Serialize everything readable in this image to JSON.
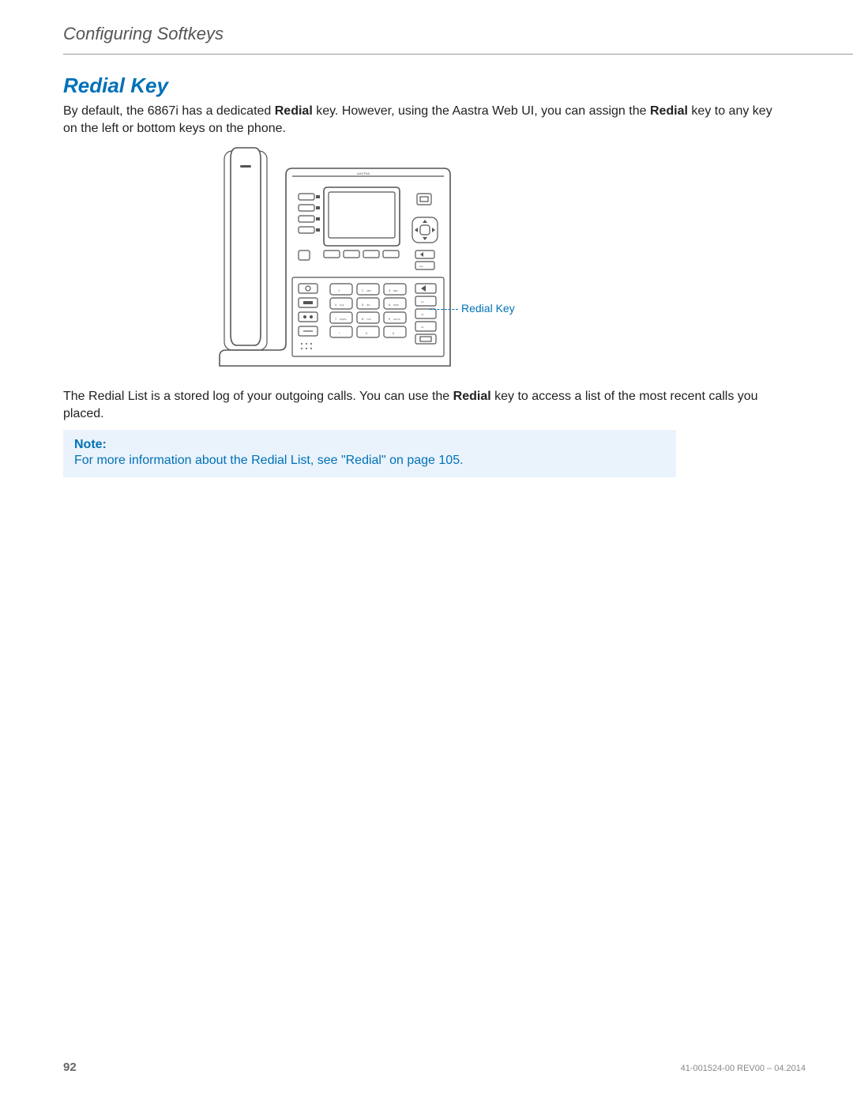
{
  "header": {
    "section": "Configuring Softkeys"
  },
  "section": {
    "title": "Redial Key"
  },
  "paragraphs": {
    "p1_a": "By default, the 6867i has a dedicated ",
    "p1_b": "Redial",
    "p1_c": " key. However, using the Aastra Web UI, you can assign the ",
    "p1_d": "Redial",
    "p1_e": " key to any key on the left or bottom keys on the phone.",
    "p2_a": "The Redial List is a stored log of your outgoing calls. You can use the ",
    "p2_b": "Redial",
    "p2_c": " key to access a list of the most recent calls you placed."
  },
  "figure": {
    "brand": "AASTRA",
    "callout_label": "Redial Key",
    "keypad": {
      "1": "1",
      "2": "2",
      "2s": "ABC",
      "3": "3",
      "3s": "DEF",
      "4": "4",
      "4s": "GHI",
      "5": "5",
      "5s": "JKL",
      "6": "6",
      "6s": "MNO",
      "7": "7",
      "7s": "PQRS",
      "8": "8",
      "8s": "TUV",
      "9": "9",
      "9s": "WXYZ",
      "star": "*",
      "0": "0",
      "hash": "#"
    },
    "right_col": {
      "l1": "L1",
      "l2": "L2",
      "l3": "L3",
      "l4": "L4"
    }
  },
  "note": {
    "title": "Note:",
    "body_a": "For more information about the Redial List, see \"Redial\" on ",
    "body_link": "page 105",
    "body_b": "."
  },
  "footer": {
    "page": "92",
    "rev": "41-001524-00 REV00 – 04.2014"
  }
}
